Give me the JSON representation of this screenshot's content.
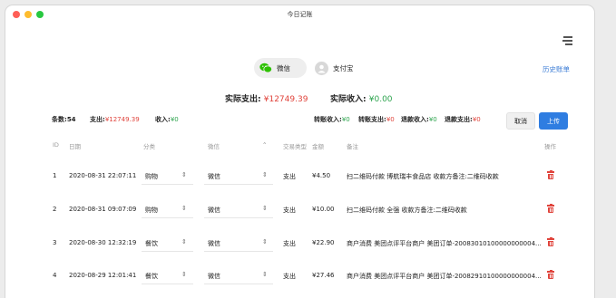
{
  "window": {
    "title": "今日记账"
  },
  "tabs": [
    {
      "label": "微信",
      "selected": true,
      "icon": "wechat-icon"
    },
    {
      "label": "支付宝",
      "selected": false,
      "icon": "avatar-icon"
    }
  ],
  "history_link": "历史账单",
  "totals": {
    "expense_label": "实际支出:",
    "expense_value": "¥12749.39",
    "income_label": "实际收入:",
    "income_value": "¥0.00"
  },
  "stats": {
    "count_label": "条数:",
    "count_value": "54",
    "expense_label": "支出:",
    "expense_value": "¥12749.39",
    "income_label": "收入:",
    "income_value": "¥0",
    "transfer_in_label": "转账收入:",
    "transfer_in_value": "¥0",
    "transfer_out_label": "转账支出:",
    "transfer_out_value": "¥0",
    "refund_in_label": "退款收入:",
    "refund_in_value": "¥0",
    "refund_out_label": "退款支出:",
    "refund_out_value": "¥0"
  },
  "buttons": {
    "cancel": "取消",
    "upload": "上传"
  },
  "table": {
    "headers": {
      "id": "ID",
      "date": "日期",
      "category": "分类",
      "account": "微信",
      "type": "交易类型",
      "amount": "金额",
      "note": "备注",
      "action": "操作"
    },
    "rows": [
      {
        "id": "1",
        "date": "2020-08-31 22:07:11",
        "category": "购物",
        "account": "微信",
        "type": "支出",
        "amount": "¥4.50",
        "note": "扫二维码付款 博航瑞丰食品店 收款方备注:二维码收款"
      },
      {
        "id": "2",
        "date": "2020-08-31 09:07:09",
        "category": "购物",
        "account": "微信",
        "type": "支出",
        "amount": "¥10.00",
        "note": "扫二维码付款 全强 收款方备注:二维码收款"
      },
      {
        "id": "3",
        "date": "2020-08-30 12:32:19",
        "category": "餐饮",
        "account": "微信",
        "type": "支出",
        "amount": "¥22.90",
        "note": "商户消费 美团点评平台商户 美团订单-20083010100000000004..."
      },
      {
        "id": "4",
        "date": "2020-08-29 12:01:41",
        "category": "餐饮",
        "account": "微信",
        "type": "支出",
        "amount": "¥27.46",
        "note": "商户消费 美团点评平台商户 美团订单-20082910100000000004..."
      }
    ]
  },
  "colors": {
    "accent": "#2f7de1",
    "expense": "#e0443c",
    "income": "#2ea44f",
    "wechat": "#2dc100"
  }
}
